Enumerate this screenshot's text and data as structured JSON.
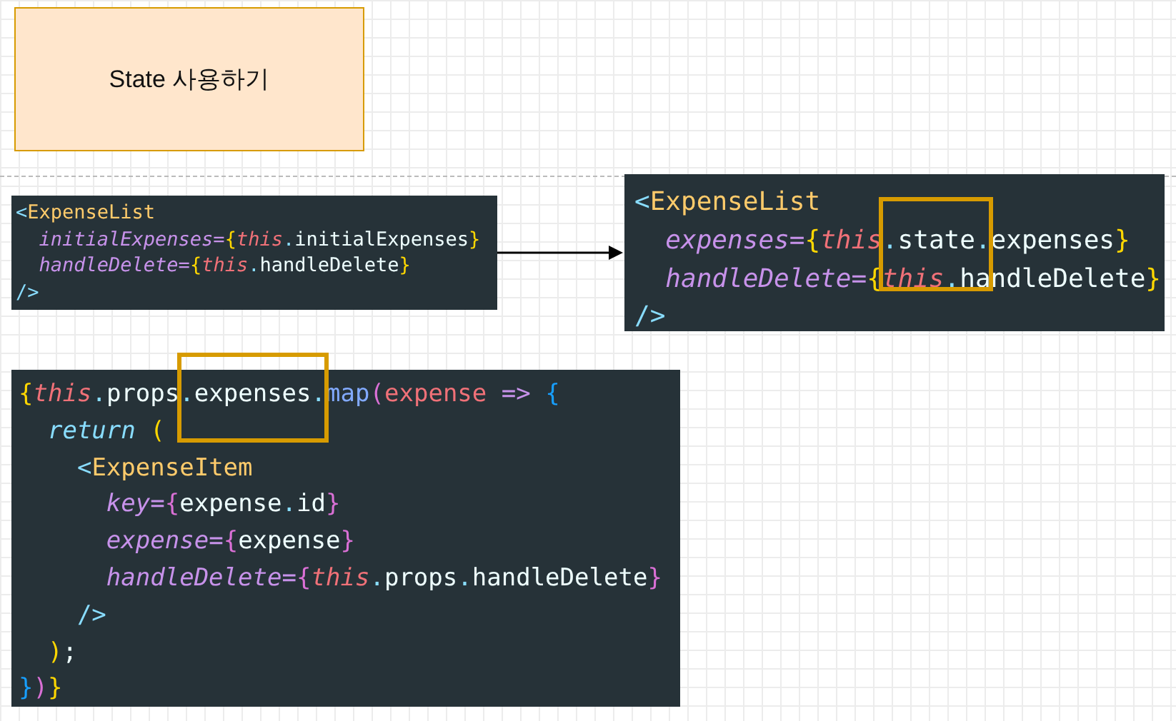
{
  "title_card": {
    "text": "State 사용하기"
  },
  "code_blocks": [
    {
      "lines": [
        [
          {
            "text": "<",
            "kind": "punct"
          },
          {
            "text": "ExpenseList",
            "kind": "tag"
          }
        ],
        [
          {
            "text": "  initialExpenses",
            "kind": "attr"
          },
          {
            "text": "=",
            "kind": "attr"
          },
          {
            "text": "{",
            "kind": "brace1"
          },
          {
            "text": "this",
            "kind": "this"
          },
          {
            "text": ".",
            "kind": "punct"
          },
          {
            "text": "initialExpenses",
            "kind": "ident"
          },
          {
            "text": "}",
            "kind": "brace1"
          }
        ],
        [
          {
            "text": "  handleDelete",
            "kind": "attr"
          },
          {
            "text": "=",
            "kind": "attr"
          },
          {
            "text": "{",
            "kind": "brace1"
          },
          {
            "text": "this",
            "kind": "this"
          },
          {
            "text": ".",
            "kind": "punct"
          },
          {
            "text": "handleDelete",
            "kind": "ident"
          },
          {
            "text": "}",
            "kind": "brace1"
          }
        ],
        [
          {
            "text": "/>",
            "kind": "punct"
          }
        ]
      ]
    },
    {
      "lines": [
        [
          {
            "text": "<",
            "kind": "punct"
          },
          {
            "text": "ExpenseList",
            "kind": "tag"
          }
        ],
        [
          {
            "text": "  expenses",
            "kind": "attr"
          },
          {
            "text": "=",
            "kind": "attr"
          },
          {
            "text": "{",
            "kind": "brace1"
          },
          {
            "text": "this",
            "kind": "this"
          },
          {
            "text": ".",
            "kind": "punct",
            "framed": true
          },
          {
            "text": "state",
            "kind": "ident",
            "framed": true
          },
          {
            "text": ".",
            "kind": "punct",
            "framed": true
          },
          {
            "text": "expenses",
            "kind": "ident"
          },
          {
            "text": "}",
            "kind": "brace1"
          }
        ],
        [
          {
            "text": "  handleDelete",
            "kind": "attr"
          },
          {
            "text": "=",
            "kind": "attr"
          },
          {
            "text": "{",
            "kind": "brace1"
          },
          {
            "text": "this",
            "kind": "this"
          },
          {
            "text": ".",
            "kind": "punct"
          },
          {
            "text": "handleDelete",
            "kind": "ident"
          },
          {
            "text": "}",
            "kind": "brace1"
          }
        ],
        [
          {
            "text": "/>",
            "kind": "punct"
          }
        ]
      ]
    },
    {
      "lines": [
        [
          {
            "text": "{",
            "kind": "brace1"
          },
          {
            "text": "this",
            "kind": "this"
          },
          {
            "text": ".",
            "kind": "punct"
          },
          {
            "text": "props",
            "kind": "ident"
          },
          {
            "text": ".",
            "kind": "punct",
            "framed": true
          },
          {
            "text": "expenses",
            "kind": "ident",
            "framed": true
          },
          {
            "text": ".",
            "kind": "punct",
            "framed": true
          },
          {
            "text": "map",
            "kind": "func"
          },
          {
            "text": "(",
            "kind": "brace2"
          },
          {
            "text": "expense",
            "kind": "param"
          },
          {
            "text": " => ",
            "kind": "op"
          },
          {
            "text": "{",
            "kind": "brace3"
          }
        ],
        [
          {
            "text": "  return",
            "kind": "keyword"
          },
          {
            "text": " (",
            "kind": "brace1"
          }
        ],
        [
          {
            "text": "    <",
            "kind": "punct"
          },
          {
            "text": "ExpenseItem",
            "kind": "tag"
          }
        ],
        [
          {
            "text": "      key",
            "kind": "attr"
          },
          {
            "text": "=",
            "kind": "attr"
          },
          {
            "text": "{",
            "kind": "brace2"
          },
          {
            "text": "expense",
            "kind": "ident"
          },
          {
            "text": ".",
            "kind": "punct"
          },
          {
            "text": "id",
            "kind": "ident"
          },
          {
            "text": "}",
            "kind": "brace2"
          }
        ],
        [
          {
            "text": "      expense",
            "kind": "attr"
          },
          {
            "text": "=",
            "kind": "attr"
          },
          {
            "text": "{",
            "kind": "brace2"
          },
          {
            "text": "expense",
            "kind": "ident"
          },
          {
            "text": "}",
            "kind": "brace2"
          }
        ],
        [
          {
            "text": "      handleDelete",
            "kind": "attr"
          },
          {
            "text": "=",
            "kind": "attr"
          },
          {
            "text": "{",
            "kind": "brace2"
          },
          {
            "text": "this",
            "kind": "this"
          },
          {
            "text": ".",
            "kind": "punct"
          },
          {
            "text": "props",
            "kind": "ident"
          },
          {
            "text": ".",
            "kind": "punct"
          },
          {
            "text": "handleDelete",
            "kind": "ident"
          },
          {
            "text": "}",
            "kind": "brace2"
          }
        ],
        [
          {
            "text": "    />",
            "kind": "punct"
          }
        ],
        [
          {
            "text": "  )",
            "kind": "brace1"
          },
          {
            "text": ";",
            "kind": "ident"
          }
        ],
        [
          {
            "text": "}",
            "kind": "brace3"
          },
          {
            "text": ")",
            "kind": "brace2"
          },
          {
            "text": "}",
            "kind": "brace1"
          }
        ]
      ]
    }
  ]
}
